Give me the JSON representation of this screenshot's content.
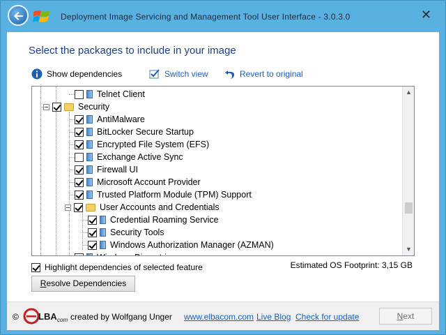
{
  "window": {
    "title": "Deployment Image Servicing and Management Tool User Interface   -  3.0.3.0",
    "close_glyph": "✕"
  },
  "main": {
    "heading": "Select the packages to include in your image"
  },
  "toolbar": {
    "show_dependencies": "Show dependencies",
    "switch_view": "Switch view",
    "revert": "Revert to original"
  },
  "tree": {
    "rows": [
      {
        "label": "Telnet Client",
        "checked": false,
        "type": "item",
        "level": 2
      },
      {
        "label": "Security",
        "checked": true,
        "type": "folder",
        "level": 1
      },
      {
        "label": "AntiMalware",
        "checked": true,
        "type": "item",
        "level": 2
      },
      {
        "label": "BitLocker Secure Startup",
        "checked": true,
        "type": "item",
        "level": 2
      },
      {
        "label": "Encrypted File System (EFS)",
        "checked": true,
        "type": "item",
        "level": 2
      },
      {
        "label": "Exchange Active Sync",
        "checked": false,
        "type": "item",
        "level": 2
      },
      {
        "label": "Firewall UI",
        "checked": true,
        "type": "item",
        "level": 2
      },
      {
        "label": "Microsoft Account Provider",
        "checked": true,
        "type": "item",
        "level": 2
      },
      {
        "label": "Trusted Platform Module (TPM) Support",
        "checked": true,
        "type": "item",
        "level": 2
      },
      {
        "label": "User Accounts and Credentials",
        "checked": true,
        "type": "folder",
        "level": 2
      },
      {
        "label": "Credential Roaming Service",
        "checked": true,
        "type": "item",
        "level": 3
      },
      {
        "label": "Security Tools",
        "checked": true,
        "type": "item",
        "level": 3
      },
      {
        "label": "Windows Authorization Manager (AZMAN)",
        "checked": true,
        "type": "item",
        "level": 3
      },
      {
        "label": "Windows Biometrics",
        "checked": true,
        "type": "item",
        "level": 2
      }
    ]
  },
  "options": {
    "highlight_label": "Highlight dependencies of selected feature",
    "highlight_checked": true,
    "footprint": "Estimated OS Footprint: 3,15 GB",
    "resolve_pre": "",
    "resolve_ul": "R",
    "resolve_post": "esolve Dependencies"
  },
  "footer": {
    "copyright": "©",
    "created_by": "created by Wolfgang Unger",
    "website": "www.elbacom.com",
    "live_blog": "Live Blog",
    "check_update": "Check for update",
    "next_ul": "N",
    "next_post": "ext",
    "logo_text_1": "LBA",
    "logo_text_2": "com"
  },
  "colors": {
    "accent": "#59b1e2",
    "heading": "#1e3f8c",
    "link": "#1560c7"
  }
}
